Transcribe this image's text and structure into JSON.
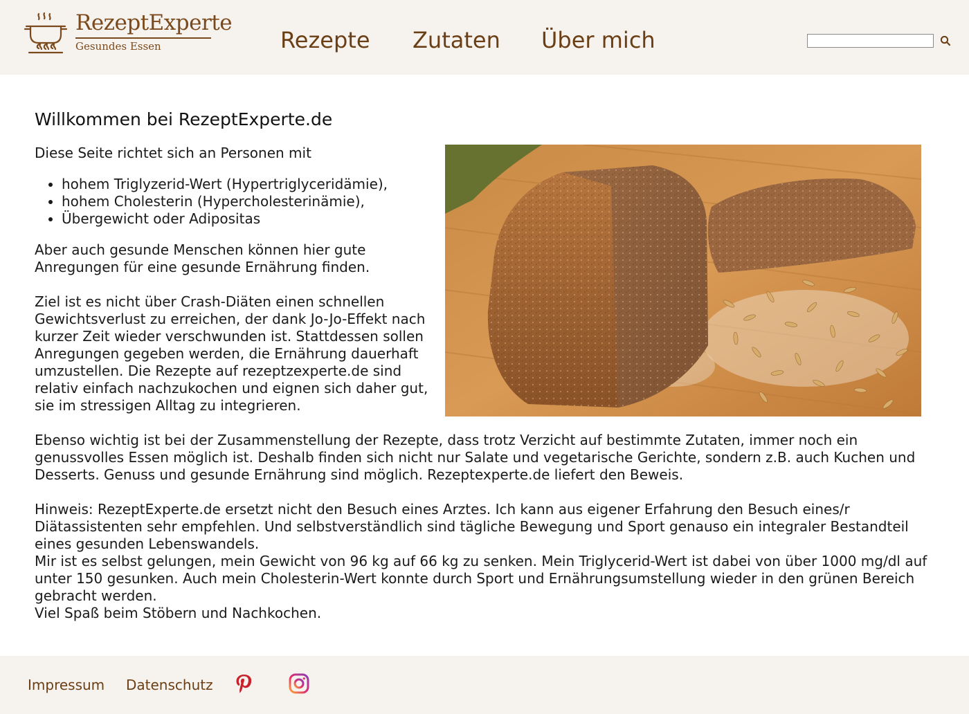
{
  "header": {
    "logo_title": "RezeptExperte",
    "logo_subtitle": "Gesundes Essen",
    "nav": [
      {
        "label": "Rezepte"
      },
      {
        "label": "Zutaten"
      },
      {
        "label": "Über mich"
      }
    ],
    "search": {
      "value": "",
      "placeholder": ""
    }
  },
  "main": {
    "title": "Willkommen bei RezeptExperte.de",
    "intro": "Diese Seite richtet sich an Personen mit",
    "bullets": [
      "hohem Triglyzerid-Wert (Hypertriglyceridämie),",
      "hohem Cholesterin (Hypercholesterinämie),",
      "Übergewicht oder Adipositas"
    ],
    "paragraphs": [
      "Aber auch gesunde Menschen können hier gute Anregungen für eine gesunde Ernährung finden.",
      "Ziel ist es nicht über Crash-Diäten einen schnellen Gewichtsverlust zu erreichen, der dank Jo-Jo-Effekt nach kurzer Zeit wieder verschwunden ist. Stattdessen sollen Anregungen gegeben werden, die Ernährung dauerhaft umzustellen. Die Rezepte auf rezeptzexperte.de sind relativ einfach nachzukochen und eignen sich daher gut, sie im stressigen Alltag zu integrieren.",
      "Ebenso wichtig ist bei der Zusammenstellung der Rezepte, dass trotz Verzicht auf bestimmte Zutaten, immer noch ein genussvolles Essen möglich ist. Deshalb finden sich nicht nur Salate und vegetarische Gerichte, sondern z.B. auch Kuchen und Desserts. Genuss und gesunde Ernährung sind möglich. Rezeptexperte.de liefert den Beweis.",
      "Hinweis: RezeptExperte.de ersetzt nicht den Besuch eines Arztes. Ich kann aus eigener Erfahrung den Besuch eines/r Diätassistenten sehr empfehlen. Und selbstverständlich sind tägliche Bewegung und Sport genauso ein integraler Bestandteil eines gesunden Lebenswandels.",
      "Mir ist es selbst gelungen, mein Gewicht von 96 kg auf 66 kg zu senken. Mein Triglycerid-Wert ist dabei von über 1000 mg/dl auf unter 150 gesunken. Auch mein Cholesterin-Wert konnte durch Sport und Ernährungsumstellung wieder in den grünen Bereich gebracht werden.",
      "Viel Spaß beim Stöbern und Nachkochen."
    ]
  },
  "footer": {
    "links": [
      {
        "label": "Impressum"
      },
      {
        "label": "Datenschutz"
      }
    ],
    "social": [
      {
        "icon": "pinterest-icon",
        "color": "#c8232c"
      },
      {
        "icon": "instagram-icon",
        "color": "#d6249f"
      }
    ]
  },
  "colors": {
    "brand_brown": "#7b4a1c",
    "nav_brown": "#6b3f16",
    "header_bg": "#f6f2ee"
  }
}
